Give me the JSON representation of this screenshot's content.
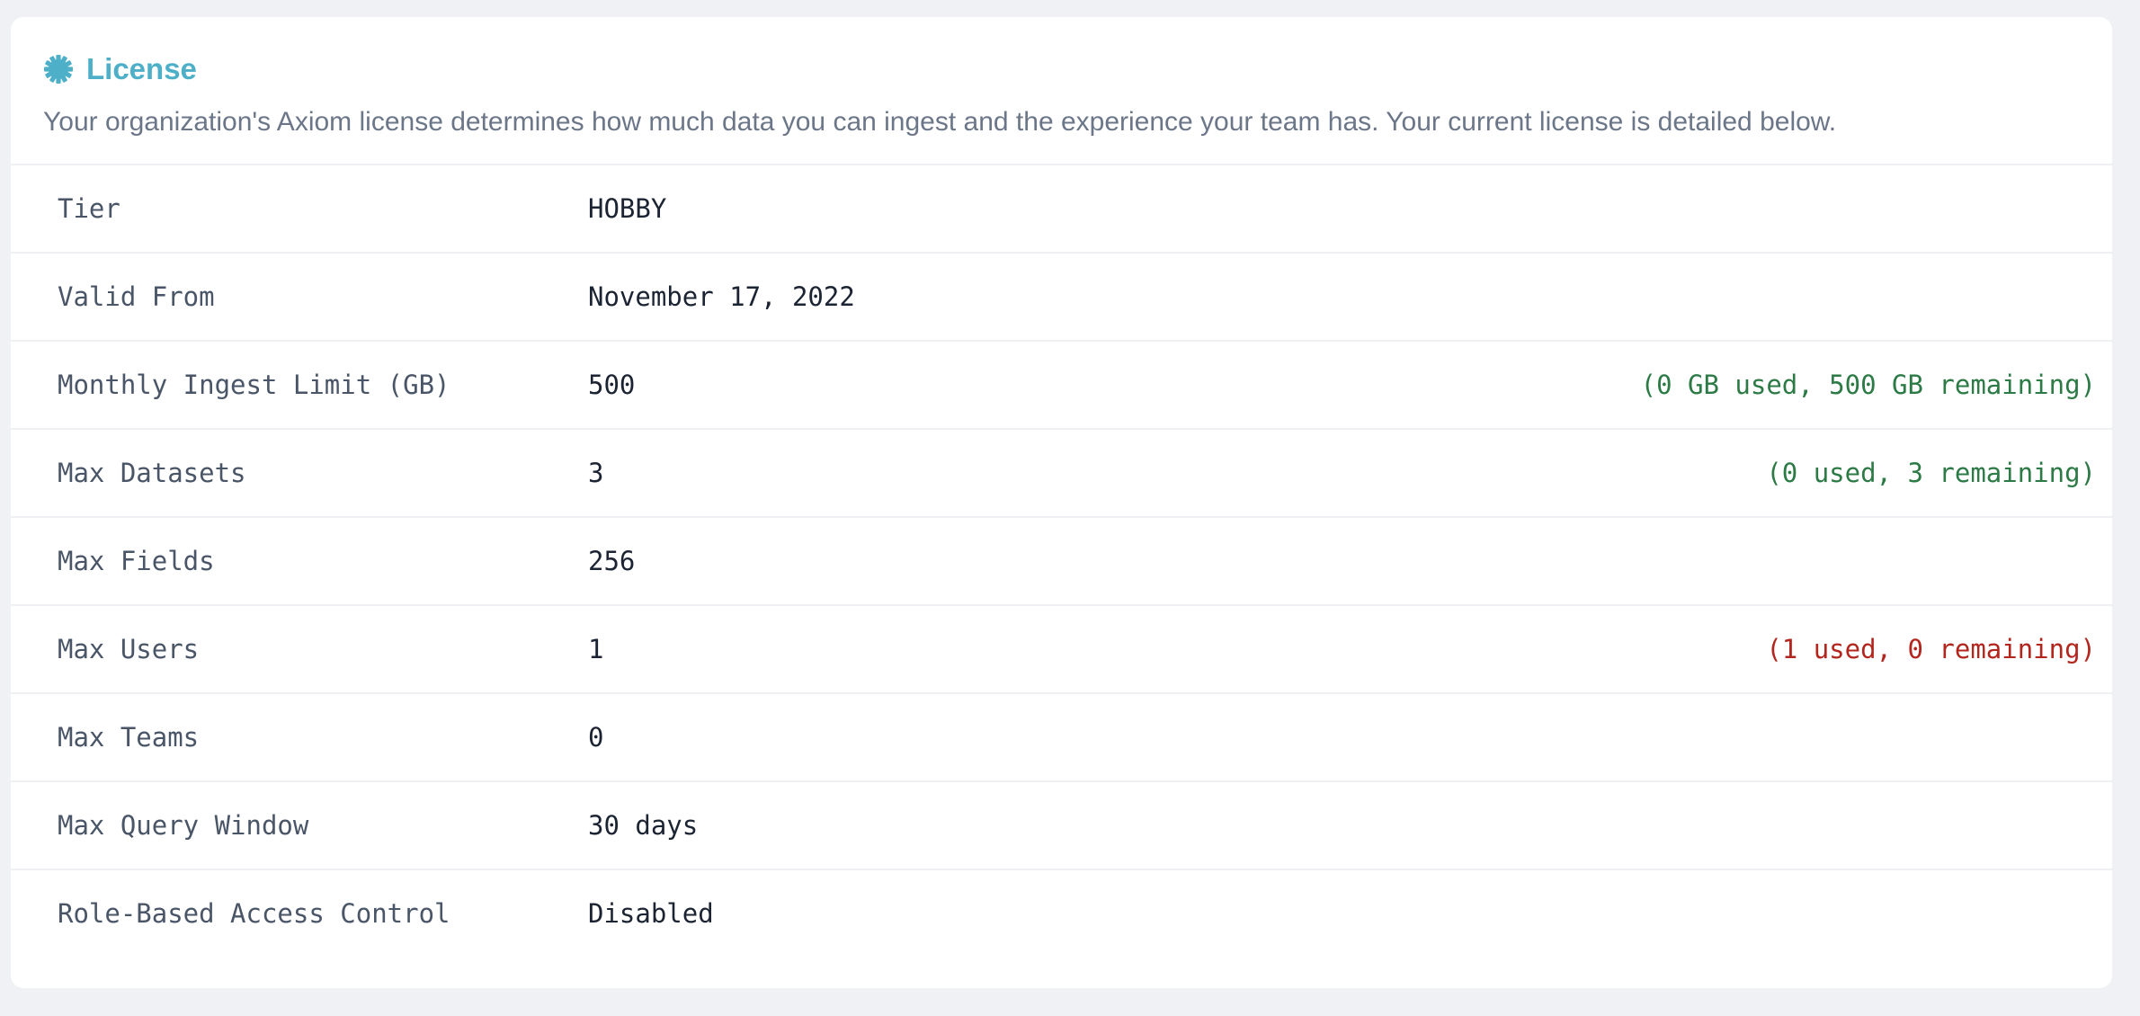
{
  "license": {
    "title": "License",
    "icon": "badge-icon",
    "accent_color": "#4eb0c8",
    "description": "Your organization's Axiom license determines how much data you can ingest and the experience your team has. Your current license is detailed below."
  },
  "rows": [
    {
      "label": "Tier",
      "value": "HOBBY",
      "usage": ""
    },
    {
      "label": "Valid From",
      "value": "November 17, 2022",
      "usage": ""
    },
    {
      "label": "Monthly Ingest Limit (GB)",
      "value": "500",
      "usage": "(0 GB used, 500 GB remaining)",
      "usage_status": "ok"
    },
    {
      "label": "Max Datasets",
      "value": "3",
      "usage": "(0 used, 3 remaining)",
      "usage_status": "ok"
    },
    {
      "label": "Max Fields",
      "value": "256",
      "usage": ""
    },
    {
      "label": "Max Users",
      "value": "1",
      "usage": "(1 used, 0 remaining)",
      "usage_status": "bad"
    },
    {
      "label": "Max Teams",
      "value": "0",
      "usage": ""
    },
    {
      "label": "Max Query Window",
      "value": "30 days",
      "usage": ""
    },
    {
      "label": "Role-Based Access Control",
      "value": "Disabled",
      "usage": ""
    }
  ],
  "colors": {
    "usage_ok": "#2c7a45",
    "usage_bad": "#b3261e"
  }
}
